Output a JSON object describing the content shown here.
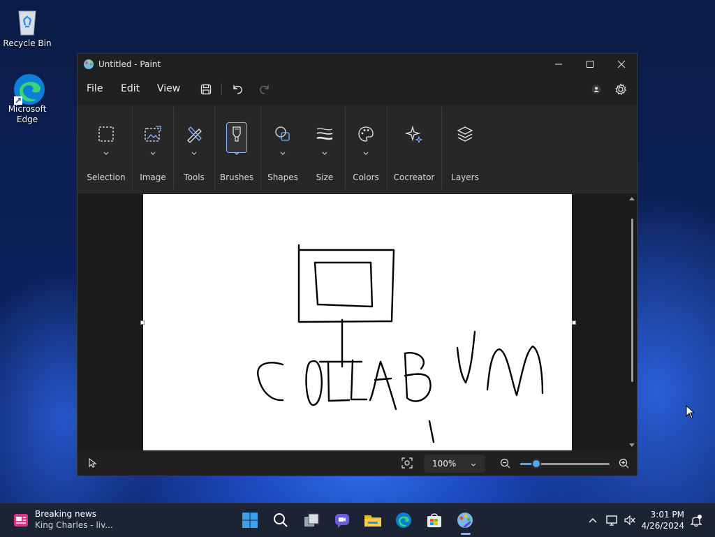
{
  "desktop": {
    "icons": [
      {
        "label": "Recycle Bin"
      },
      {
        "label": "Microsoft Edge"
      }
    ]
  },
  "window": {
    "title": "Untitled - Paint",
    "menu": [
      "File",
      "Edit",
      "View"
    ],
    "ribbon": [
      {
        "label": "Selection",
        "icon": "selection-icon"
      },
      {
        "label": "Image",
        "icon": "image-icon"
      },
      {
        "label": "Tools",
        "icon": "tools-icon"
      },
      {
        "label": "Brushes",
        "icon": "brush-icon",
        "selected": true
      },
      {
        "label": "Shapes",
        "icon": "shapes-icon"
      },
      {
        "label": "Size",
        "icon": "size-icon"
      },
      {
        "label": "Colors",
        "icon": "palette-icon"
      },
      {
        "label": "Cocreator",
        "icon": "sparkle-icon"
      },
      {
        "label": "Layers",
        "icon": "layers-icon"
      }
    ],
    "status": {
      "zoom": "100%",
      "zoom_level": 0.18
    }
  },
  "taskbar": {
    "news_title": "Breaking news",
    "news_sub": "King Charles - liv...",
    "time": "3:01 PM",
    "date": "4/26/2024"
  },
  "colors": {
    "accent": "#4fa8ff",
    "window_bg": "#202020",
    "ribbon_bg": "#272727"
  }
}
